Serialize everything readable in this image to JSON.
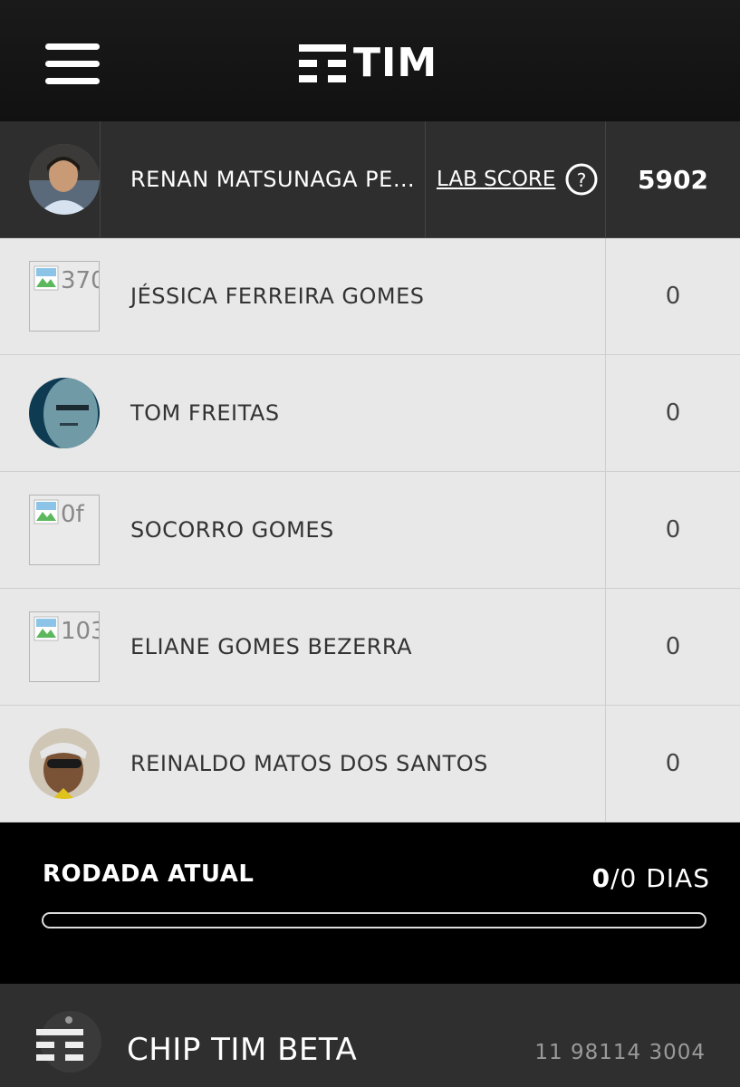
{
  "header": {
    "logo_text": "TIM",
    "menu_icon": "hamburger-menu-icon"
  },
  "current_user": {
    "name": "RENAN MATSUNAGA PER...",
    "lab_score_label": "LAB SCORE",
    "score": "5902"
  },
  "participants": [
    {
      "name": "JÉSSICA FERREIRA GOMES",
      "score": "0",
      "photo": "broken",
      "alt": "370"
    },
    {
      "name": "TOM FREITAS",
      "score": "0",
      "photo": "photo"
    },
    {
      "name": "SOCORRO GOMES",
      "score": "0",
      "photo": "broken",
      "alt": "0f"
    },
    {
      "name": "ELIANE GOMES BEZERRA",
      "score": "0",
      "photo": "broken",
      "alt": "103"
    },
    {
      "name": "REINALDO MATOS DOS SANTOS",
      "score": "0",
      "photo": "photo"
    }
  ],
  "round": {
    "label": "RODADA ATUAL",
    "current": "0",
    "total": "/0 DIAS",
    "progress": 0
  },
  "footer": {
    "chip_name": "CHIP TIM BETA",
    "phone": "11 98114 3004"
  },
  "colors": {
    "header_bg": "#141414",
    "list_bg": "#e8e8e8",
    "me_row_bg": "#2e2e2e",
    "footer_bg": "#2f2f2f"
  }
}
